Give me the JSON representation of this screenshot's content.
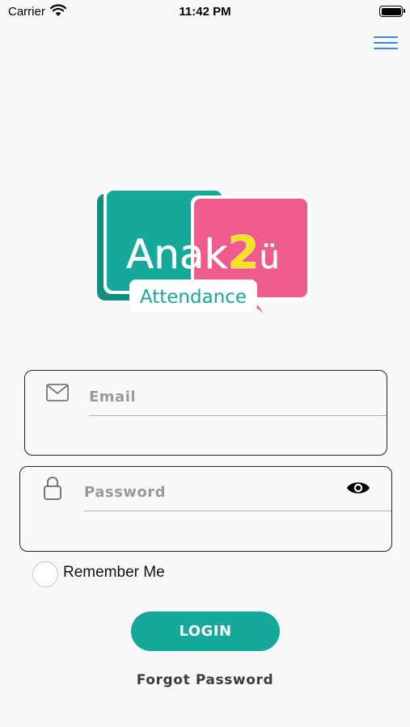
{
  "status_bar": {
    "carrier": "Carrier",
    "time": "11:42 PM"
  },
  "header": {
    "menu_icon": "hamburger-menu-icon",
    "accent_color": "#3b87e8"
  },
  "logo": {
    "brand_prefix": "Anak",
    "brand_number": "2",
    "brand_suffix": "ü",
    "subtitle": "Attendance",
    "teal": "#14a99a",
    "pink": "#ef5b8c",
    "yellow": "#f7e01e"
  },
  "form": {
    "email": {
      "placeholder": "Email",
      "value": "",
      "icon": "mail-icon"
    },
    "password": {
      "placeholder": "Password",
      "value": "",
      "icon": "lock-icon",
      "toggle_icon": "eye-icon"
    },
    "remember_label": "Remember Me",
    "remember_checked": false,
    "login_label": "LOGIN",
    "forgot_label": "Forgot Password"
  },
  "colors": {
    "primary": "#14a99a",
    "background": "#f8f8f8"
  }
}
